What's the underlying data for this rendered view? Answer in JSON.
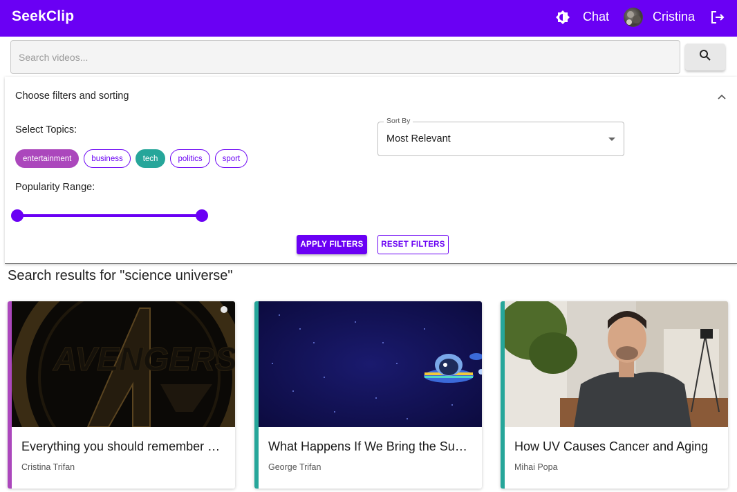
{
  "header": {
    "brand": "SeekClip",
    "chat_label": "Chat",
    "username": "Cristina",
    "accent_color": "#6a00f4"
  },
  "search": {
    "placeholder": "Search videos...",
    "value": ""
  },
  "filters": {
    "title": "Choose filters and sorting",
    "topics_label": "Select Topics:",
    "topics": [
      {
        "label": "entertainment",
        "selected": true,
        "color": "#ab47bc"
      },
      {
        "label": "business",
        "selected": false
      },
      {
        "label": "tech",
        "selected": true,
        "color": "#26a69a"
      },
      {
        "label": "politics",
        "selected": false
      },
      {
        "label": "sport",
        "selected": false
      }
    ],
    "popularity_label": "Popularity Range:",
    "popularity_range": [
      0,
      100
    ],
    "sort_label": "Sort By",
    "sort_value": "Most Relevant",
    "apply_label": "APPLY FILTERS",
    "reset_label": "RESET FILTERS"
  },
  "results": {
    "heading": "Search results for \"science universe\"",
    "cards": [
      {
        "title": "Everything you should remember before watching Avengers: Endgame",
        "author": "Cristina Trifan",
        "accent": "#ab47bc",
        "thumbnail": "avengers-logo"
      },
      {
        "title": "What Happens If We Bring the Sun to Earth?",
        "author": "George Trifan",
        "accent": "#26a69a",
        "thumbnail": "space-bird-ufo"
      },
      {
        "title": "How UV Causes Cancer and Aging",
        "author": "Mihai Popa",
        "accent": "#26a69a",
        "thumbnail": "man-in-living-room"
      }
    ]
  }
}
